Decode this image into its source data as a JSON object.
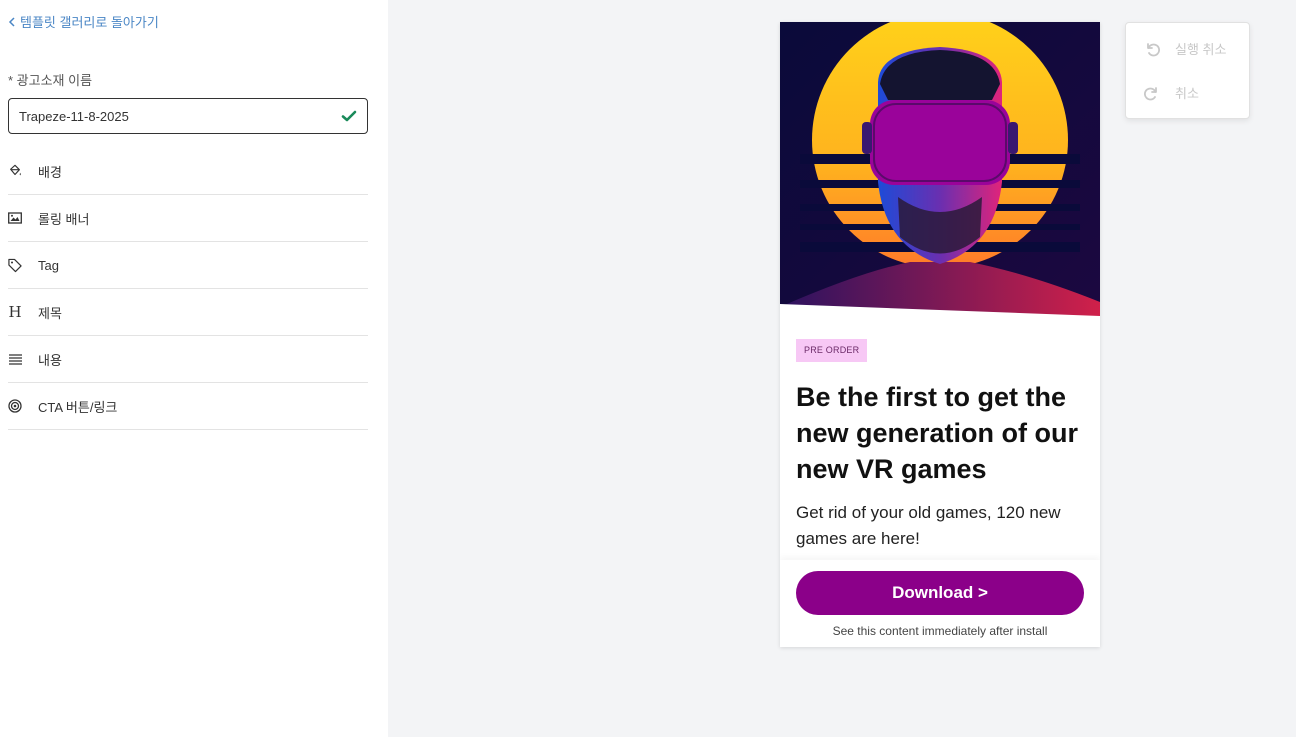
{
  "sidebar": {
    "back_label": "템플릿 갤러리로 돌아가기",
    "name_field": {
      "label": "* 광고소재 이름",
      "value": "Trapeze-11-8-2025"
    },
    "menu_items": [
      {
        "label": "배경",
        "icon": "paint-bucket-icon"
      },
      {
        "label": "롤링 배너",
        "icon": "image-icon"
      },
      {
        "label": "Tag",
        "icon": "tag-icon"
      },
      {
        "label": "제목",
        "icon": "heading-icon"
      },
      {
        "label": "내용",
        "icon": "text-lines-icon"
      },
      {
        "label": "CTA 버튼/링크",
        "icon": "target-icon"
      }
    ]
  },
  "history": {
    "undo_label": "실행 취소",
    "redo_label": "취소"
  },
  "ad": {
    "badge": "PRE ORDER",
    "headline": "Be the first to get the new generation of our new VR games",
    "subtext": "Get rid of your old games, 120 new games are here!",
    "cta_label": "Download >",
    "cta_note": "See this content immediately after install"
  },
  "colors": {
    "accent_link": "#4a86c5",
    "cta_purple": "#8b0089",
    "badge_bg": "#f7c8f5",
    "check_green": "#1a8a5a"
  }
}
